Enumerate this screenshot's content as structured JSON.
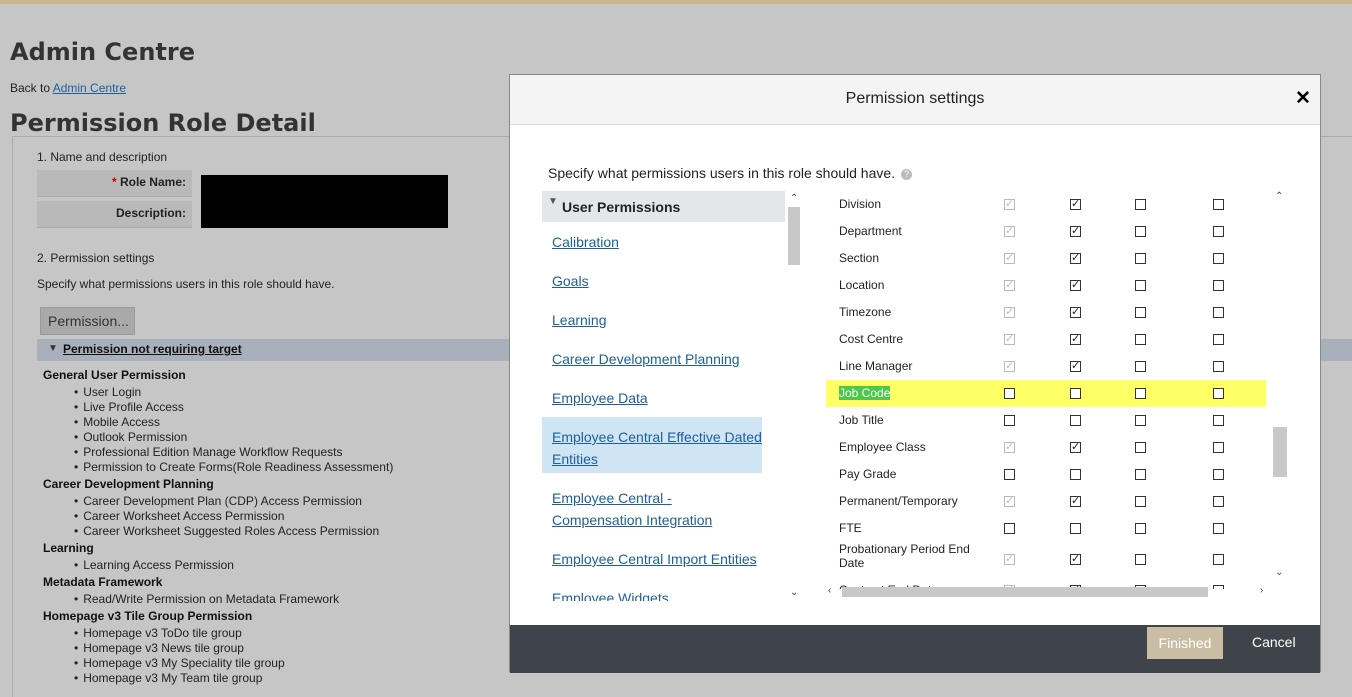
{
  "page": {
    "title": "Admin Centre",
    "back_prefix": "Back to",
    "back_link": "Admin Centre",
    "subtitle": "Permission Role Detail"
  },
  "form": {
    "section1": "1. Name and description",
    "role_name_label": "Role Name:",
    "description_label": "Description:",
    "section2": "2. Permission settings",
    "section2_desc": "Specify what permissions users in this role should have.",
    "permission_button": "Permission...",
    "bar_label": "Permission not requiring target"
  },
  "permission_groups": [
    {
      "name": "General User Permission",
      "items": [
        "User Login",
        "Live Profile Access",
        "Mobile Access",
        "Outlook Permission",
        "Professional Edition Manage Workflow Requests",
        "Permission to Create Forms(Role Readiness Assessment)"
      ]
    },
    {
      "name": "Career Development Planning",
      "items": [
        "Career Development Plan (CDP) Access Permission",
        "Career Worksheet Access Permission",
        "Career Worksheet Suggested Roles Access Permission"
      ]
    },
    {
      "name": "Learning",
      "items": [
        "Learning Access Permission"
      ]
    },
    {
      "name": "Metadata Framework",
      "items": [
        "Read/Write Permission on Metadata Framework"
      ]
    },
    {
      "name": "Homepage v3 Tile Group Permission",
      "items": [
        "Homepage v3 ToDo tile group",
        "Homepage v3 News tile group",
        "Homepage v3 My Speciality tile group",
        "Homepage v3 My Team tile group"
      ]
    }
  ],
  "modal": {
    "title": "Permission settings",
    "close_icon": "close-icon",
    "intro": "Specify what permissions users in this role should have.",
    "help_icon": "?",
    "nav_header": "User Permissions",
    "nav_items": [
      "Calibration",
      "Goals",
      "Learning",
      "Career Development Planning",
      "Employee Data",
      "Employee Central Effective Dated Entities",
      "Employee Central - Compensation Integration",
      "Employee Central Import Entities",
      "Employee Widgets"
    ],
    "nav_selected": "Employee Central Effective Dated Entities",
    "finished": "Finished",
    "cancel": "Cancel"
  },
  "field_rows": [
    {
      "label": "Division",
      "c": [
        "dchk",
        "chk",
        "",
        ""
      ]
    },
    {
      "label": "Department",
      "c": [
        "dchk",
        "chk",
        "",
        ""
      ]
    },
    {
      "label": "Section",
      "c": [
        "dchk",
        "chk",
        "",
        ""
      ]
    },
    {
      "label": "Location",
      "c": [
        "dchk",
        "chk",
        "",
        ""
      ]
    },
    {
      "label": "Timezone",
      "c": [
        "dchk",
        "chk",
        "",
        ""
      ]
    },
    {
      "label": "Cost Centre",
      "c": [
        "dchk",
        "chk",
        "",
        ""
      ]
    },
    {
      "label": "Line Manager",
      "c": [
        "dchk",
        "chk",
        "",
        ""
      ]
    },
    {
      "label": "Job Code",
      "c": [
        "",
        "",
        "",
        ""
      ],
      "highlighted": true
    },
    {
      "label": "Job Title",
      "c": [
        "",
        "",
        "",
        ""
      ]
    },
    {
      "label": "Employee Class",
      "c": [
        "dchk",
        "chk",
        "",
        ""
      ]
    },
    {
      "label": "Pay Grade",
      "c": [
        "",
        "",
        "",
        ""
      ]
    },
    {
      "label": "Permanent/Temporary",
      "c": [
        "dchk",
        "chk",
        "",
        ""
      ]
    },
    {
      "label": "FTE",
      "c": [
        "",
        "",
        "",
        ""
      ]
    },
    {
      "label": "Probationary Period End Date",
      "c": [
        "dchk",
        "chk",
        "",
        ""
      ],
      "tall": true
    },
    {
      "label": "Contract End Date",
      "c": [
        "dchk",
        "chk",
        "",
        ""
      ]
    }
  ],
  "colors": {
    "highlight": "#ffff66",
    "link": "#1d5f99",
    "footer": "#3f444a",
    "finished_bg": "#c9bda3"
  }
}
